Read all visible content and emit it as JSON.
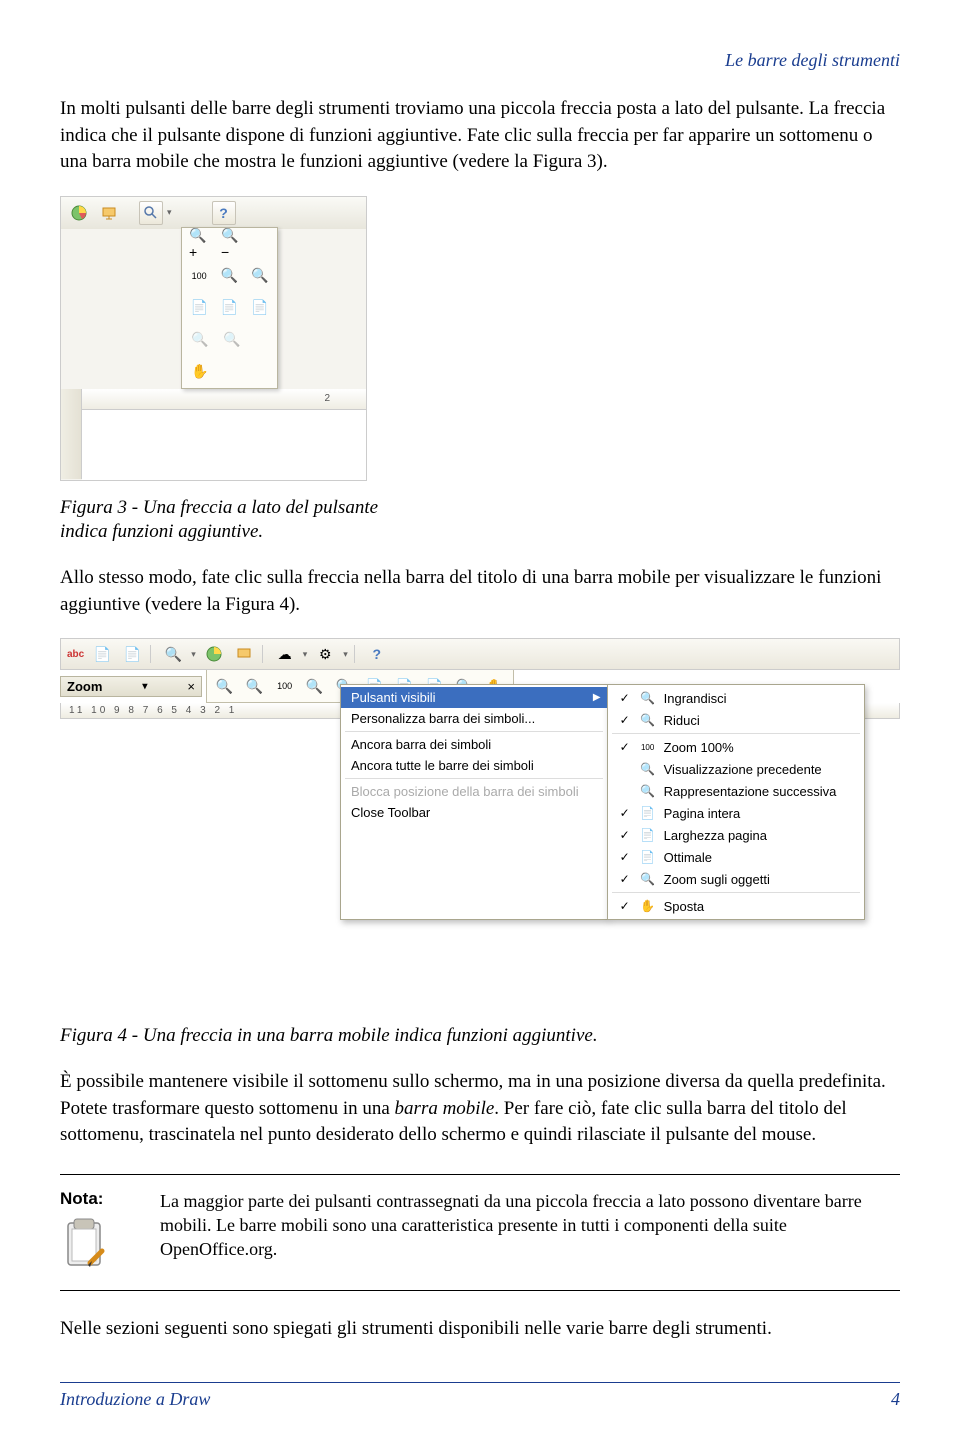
{
  "header": {
    "title": "Le barre degli strumenti"
  },
  "para1": "In molti pulsanti delle barre degli strumenti troviamo una piccola freccia posta a lato del pulsante. La freccia indica che il pulsante dispone di funzioni aggiuntive. Fate clic sulla freccia per far apparire un sottomenu o una barra mobile che mostra le funzioni aggiuntive (vedere la Figura 3).",
  "fig3": {
    "ruler_mark": "2",
    "caption": "Figura 3 - Una freccia a lato del pulsante indica funzioni aggiuntive."
  },
  "para2": "Allo stesso modo, fate clic sulla freccia nella barra del titolo di una barra mobile per visualizzare le funzioni aggiuntive (vedere la Figura 4).",
  "fig4": {
    "abc_label": "abc",
    "zoom_title": "Zoom",
    "close_x": "×",
    "ruler": "11  10  9  8  7  6  5  4  3  2  1",
    "menu1": {
      "pulsanti": "Pulsanti visibili",
      "personalizza": "Personalizza barra dei simboli...",
      "ancora": "Ancora barra dei simboli",
      "ancora_tutte": "Ancora tutte le barre dei simboli",
      "blocca": "Blocca posizione della barra dei simboli",
      "close": "Close Toolbar"
    },
    "menu2": {
      "ingrandisci": "Ingrandisci",
      "riduci": "Riduci",
      "zoom100": "Zoom 100%",
      "vis_prec": "Visualizzazione precedente",
      "rappr_succ": "Rappresentazione successiva",
      "pagina_intera": "Pagina intera",
      "larghezza": "Larghezza pagina",
      "ottimale": "Ottimale",
      "zoom_ogg": "Zoom sugli oggetti",
      "sposta": "Sposta"
    },
    "caption": "Figura 4 - Una freccia in una barra mobile indica funzioni aggiuntive."
  },
  "para3_a": "È possibile mantenere visibile il sottomenu sullo schermo, ma in una posizione diversa da quella predefinita. Potete trasformare questo sottomenu in una ",
  "para3_b": "barra mobile",
  "para3_c": ". Per fare ciò, fate clic sulla barra del titolo del sottomenu, trascinatela nel punto desiderato dello schermo e quindi rilasciate il pulsante del mouse.",
  "note": {
    "label": "Nota:",
    "text": "La maggior parte dei pulsanti contrassegnati da una piccola freccia a lato possono diventare barre mobili. Le barre mobili sono una caratteristica presente in tutti i componenti della suite OpenOffice.org."
  },
  "para4": "Nelle sezioni seguenti sono spiegati gli strumenti disponibili nelle varie barre degli strumenti.",
  "footer": {
    "left": "Introduzione a Draw",
    "right": "4"
  }
}
